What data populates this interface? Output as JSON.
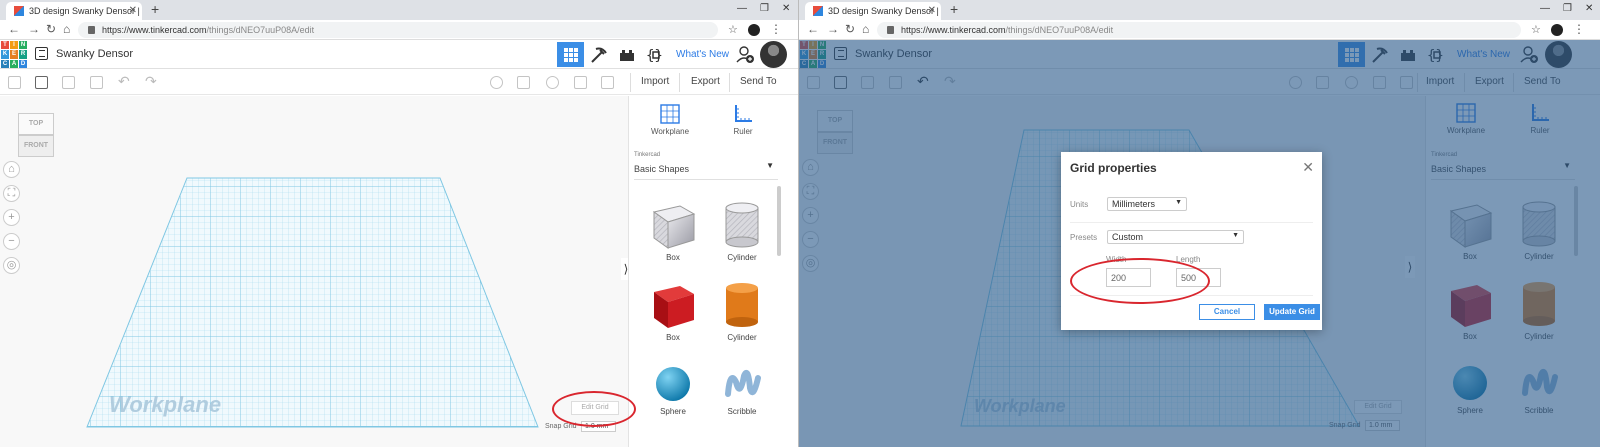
{
  "browser": {
    "tab_title": "3D design Swanky Densor | Tink",
    "url_host": "https://www.tinkercad.com",
    "url_path": "/things/dNEO7uuP08A/edit"
  },
  "app": {
    "logo_letters": [
      "T",
      "I",
      "N",
      "K",
      "E",
      "R",
      "C",
      "A",
      "D"
    ],
    "design_title": "Swanky Densor",
    "whats_new": "What's New",
    "import": "Import",
    "export": "Export",
    "send_to": "Send To",
    "colors": {
      "accent": "#3b8ee6",
      "grid": "#a9dcef",
      "overlay": "#2c5a8a",
      "highlight": "#d9262e"
    }
  },
  "viewcube": {
    "top": "TOP",
    "front": "FRONT"
  },
  "workplane": {
    "label": "Workplane",
    "edit_grid": "Edit Grid",
    "snap_label": "Snap Grid",
    "snap_value": "1.0 mm"
  },
  "panel": {
    "workplane_tool": "Workplane",
    "ruler_tool": "Ruler",
    "category_small": "Tinkercad",
    "category_main": "Basic Shapes",
    "shapes": [
      "Box",
      "Cylinder",
      "Box",
      "Cylinder",
      "Sphere",
      "Scribble"
    ]
  },
  "dialog": {
    "title": "Grid properties",
    "units_label": "Units",
    "units_value": "Millimeters",
    "presets_label": "Presets",
    "presets_value": "Custom",
    "width_label": "Width",
    "length_label": "Length",
    "width_value": "200",
    "length_value": "500",
    "cancel": "Cancel",
    "update": "Update Grid"
  }
}
